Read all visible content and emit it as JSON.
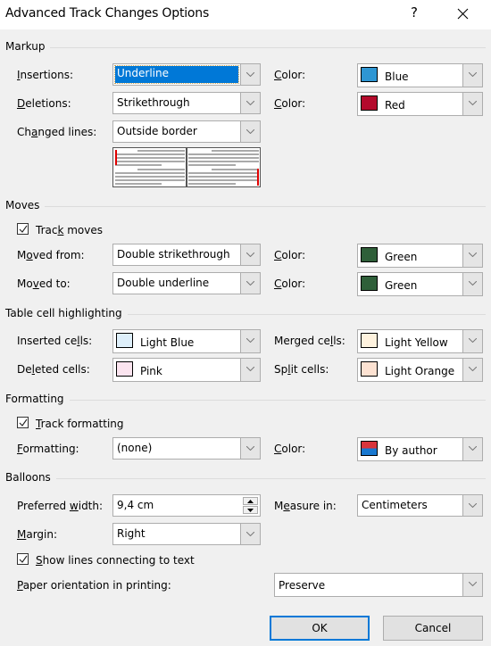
{
  "window": {
    "title": "Advanced Track Changes Options",
    "help_label": "?",
    "close_icon": "close-icon"
  },
  "markup": {
    "group_label": "Markup",
    "insertions": {
      "label": "Insertions:",
      "mnemonic": "I",
      "value": "Underline",
      "color_label": "Color:",
      "color_value": "Blue",
      "color_swatch": "#2e96d3"
    },
    "deletions": {
      "label": "Deletions:",
      "mnemonic": "D",
      "value": "Strikethrough",
      "color_label": "Color:",
      "color_value": "Red",
      "color_swatch": "#b40a2c"
    },
    "changed_lines": {
      "label": "Changed lines:",
      "value": "Outside border"
    }
  },
  "moves": {
    "group_label": "Moves",
    "track_moves": {
      "label": "Track moves",
      "checked": true
    },
    "moved_from": {
      "label": "Moved from:",
      "value": "Double strikethrough",
      "color_label": "Color:",
      "color_value": "Green",
      "color_swatch": "#2f5f39"
    },
    "moved_to": {
      "label": "Moved to:",
      "value": "Double underline",
      "color_label": "Color:",
      "color_value": "Green",
      "color_swatch": "#2f5f39"
    }
  },
  "table_cells": {
    "group_label": "Table cell highlighting",
    "inserted": {
      "label": "Inserted cells:",
      "value": "Light Blue",
      "swatch": "#deeffa"
    },
    "deleted": {
      "label": "Deleted cells:",
      "value": "Pink",
      "swatch": "#fbe4ef"
    },
    "merged": {
      "label": "Merged cells:",
      "value": "Light Yellow",
      "swatch": "#fef2de"
    },
    "split": {
      "label": "Split cells:",
      "value": "Light Orange",
      "swatch": "#fde2d2"
    }
  },
  "formatting": {
    "group_label": "Formatting",
    "track_formatting": {
      "label": "Track formatting",
      "checked": true
    },
    "formatting": {
      "label": "Formatting:",
      "value": "(none)",
      "color_label": "Color:",
      "color_value": "By author",
      "swatch_top": "#d9353c",
      "swatch_bottom": "#1978d0"
    }
  },
  "balloons": {
    "group_label": "Balloons",
    "preferred_width": {
      "label": "Preferred width:",
      "value": "9,4 cm"
    },
    "measure_in": {
      "label": "Measure in:",
      "value": "Centimeters"
    },
    "margin": {
      "label": "Margin:",
      "value": "Right"
    },
    "show_lines": {
      "label": "Show lines connecting to text",
      "checked": true
    },
    "paper_orientation": {
      "label": "Paper orientation in printing:",
      "value": "Preserve"
    }
  },
  "buttons": {
    "ok": "OK",
    "cancel": "Cancel"
  }
}
